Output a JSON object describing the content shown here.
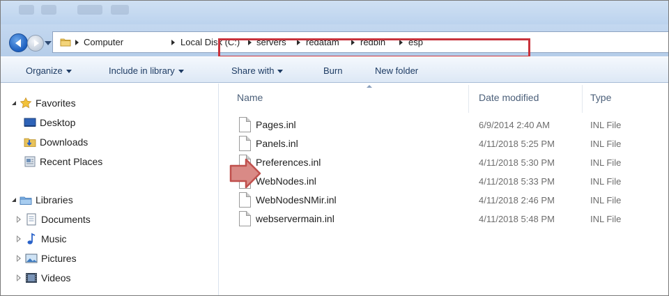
{
  "colors": {
    "highlight_border": "#c8323b",
    "arrow_fill": "#d98a86",
    "arrow_stroke": "#c0504d",
    "toolbar_text": "#1e3c64"
  },
  "navigation": {
    "back_icon": "back-arrow-icon",
    "forward_icon": "forward-arrow-icon"
  },
  "address": {
    "folder_icon": "folder-icon",
    "crumbs": [
      "Computer",
      "Local Disk (C:)",
      "servers",
      "redatam",
      "redbin",
      "esp"
    ]
  },
  "toolbar": {
    "organize": "Organize",
    "include_in_library": "Include in library",
    "share_with": "Share with",
    "burn": "Burn",
    "new_folder": "New folder"
  },
  "nav_pane": {
    "favorites": {
      "label": "Favorites",
      "items": [
        "Desktop",
        "Downloads",
        "Recent Places"
      ]
    },
    "libraries": {
      "label": "Libraries",
      "items": [
        "Documents",
        "Music",
        "Pictures",
        "Videos"
      ]
    }
  },
  "columns": {
    "name": "Name",
    "date_modified": "Date modified",
    "type": "Type"
  },
  "files": [
    {
      "name": "Pages.inl",
      "date": "6/9/2014 2:40 AM",
      "type": "INL File"
    },
    {
      "name": "Panels.inl",
      "date": "4/11/2018 5:25 PM",
      "type": "INL File"
    },
    {
      "name": "Preferences.inl",
      "date": "4/11/2018 5:30 PM",
      "type": "INL File"
    },
    {
      "name": "WebNodes.inl",
      "date": "4/11/2018 5:33 PM",
      "type": "INL File"
    },
    {
      "name": "WebNodesNMir.inl",
      "date": "4/11/2018 2:46 PM",
      "type": "INL File"
    },
    {
      "name": "webservermain.inl",
      "date": "4/11/2018 5:48 PM",
      "type": "INL File"
    }
  ]
}
